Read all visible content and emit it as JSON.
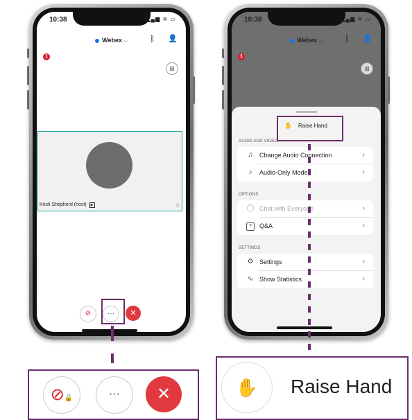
{
  "left_phone": {
    "time": "10:38",
    "status_icons": "▂▄▆ ≋ ▭",
    "app_title": "Webex",
    "title_chevron": "⌵",
    "notification_count": "1",
    "participant_name": "Kristi Shepherd (host)",
    "controls": {
      "mute_icon": "🎙̸",
      "more_label": "···",
      "end_label": "✕"
    }
  },
  "right_phone": {
    "time": "10:38",
    "status_icons": "▂▄▆ ≋ ▭",
    "app_title": "Webex",
    "title_chevron": "⌵",
    "notification_count": "1",
    "raise_hand_label": "Raise Hand",
    "sections": [
      {
        "title": "AUDIO AND VIDEO",
        "items": [
          {
            "icon": "audio-connection-icon",
            "glyph": "♫",
            "label": "Change Audio Connection",
            "enabled": true
          },
          {
            "icon": "audio-only-icon",
            "glyph": "♪",
            "label": "Audio-Only Mode",
            "enabled": true
          }
        ]
      },
      {
        "title": "OPTIONS",
        "items": [
          {
            "icon": "chat-icon",
            "glyph": "◯",
            "label": "Chat with Everyone",
            "enabled": false
          },
          {
            "icon": "qa-icon",
            "glyph": "?",
            "label": "Q&A",
            "enabled": true
          }
        ]
      },
      {
        "title": "SETTINGS",
        "items": [
          {
            "icon": "settings-icon",
            "glyph": "⚙",
            "label": "Settings",
            "enabled": true
          },
          {
            "icon": "statistics-icon",
            "glyph": "∿",
            "label": "Show Statistics",
            "enabled": true
          }
        ]
      }
    ]
  },
  "zoom_controls": {
    "more_label": "···",
    "end_label": "✕"
  },
  "zoom_raise_hand": {
    "label": "Raise Hand"
  },
  "colors": {
    "highlight": "#6b2f6d",
    "end_call": "#e03a3e",
    "tile_border": "#1aa39a",
    "badge": "#d6202b"
  }
}
